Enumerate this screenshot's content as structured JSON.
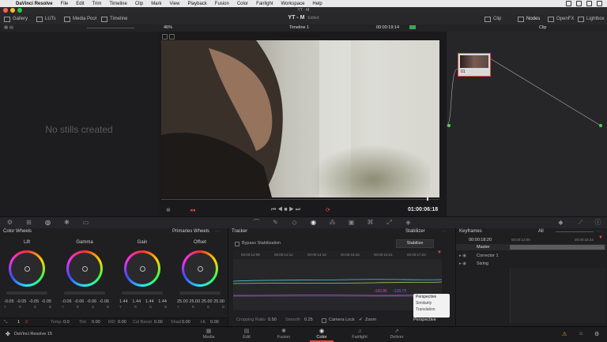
{
  "menubar": {
    "app": "DaVinci Resolve",
    "items": [
      "File",
      "Edit",
      "Trim",
      "Timeline",
      "Clip",
      "Mark",
      "View",
      "Playback",
      "Fusion",
      "Color",
      "Fairlight",
      "Workspace",
      "Help"
    ]
  },
  "window": {
    "title": "YT - M"
  },
  "toolbar": {
    "gallery": "Gallery",
    "luts": "LUTs",
    "media_pool": "Media Pool",
    "timeline": "Timeline",
    "project": "YT - M",
    "edited": "Edited",
    "clip": "Clip",
    "nodes": "Nodes",
    "openfx": "OpenFX",
    "lightbox": "Lightbox"
  },
  "viewerbar": {
    "zoom": "46%",
    "timeline_name": "Timeline 1",
    "timecode": "00:00:19:14",
    "mode": "Clip"
  },
  "gallery": {
    "empty_text": "No stills created"
  },
  "viewer": {
    "timecode": "01:00:06:18"
  },
  "node": {
    "label": "01"
  },
  "wheels": {
    "panel_title": "Color Wheels",
    "mode": "Primaries Wheels",
    "items": [
      {
        "name": "Lift",
        "values": [
          "-0.05",
          "-0.05",
          "-0.05",
          "-0.05"
        ]
      },
      {
        "name": "Gamma",
        "values": [
          "-0.06",
          "-0.06",
          "-0.06",
          "-0.06"
        ]
      },
      {
        "name": "Gain",
        "values": [
          "1.44",
          "1.44",
          "1.44",
          "1.44"
        ]
      },
      {
        "name": "Offset",
        "values": [
          "25.00",
          "25.00",
          "25.00",
          "25.00"
        ]
      }
    ],
    "channel_labels": [
      "Y",
      "R",
      "G",
      "B"
    ],
    "footer": {
      "page1": "1",
      "page2": "2",
      "temp_label": "Temp",
      "temp": "0.0",
      "tint_label": "Tint",
      "tint": "0.00",
      "md_label": "MD",
      "md": "0.00",
      "colboost_label": "Col Boost",
      "colboost": "0.00",
      "shad_label": "Shad",
      "shad": "0.00",
      "hl_label": "HL",
      "hl": "0.00"
    }
  },
  "tracker": {
    "title": "Tracker",
    "mode": "Stabilizer",
    "bypass": "Bypass Stabilization",
    "stabilize_btn": "Stabilize",
    "ruler": [
      "00:00:12:09",
      "00:00:13:12",
      "00:00:14:15",
      "00:00:15:18",
      "00:00:16:21",
      "00:00:17:24"
    ],
    "val1": "-162.85",
    "val2": "-128.73",
    "cropping_label": "Cropping Ratio",
    "cropping": "0.50",
    "smooth_label": "Smooth",
    "smooth": "0.25",
    "camlock": "Camera Lock",
    "zoom": "Zoom",
    "dropdown_options": [
      "Perspective",
      "Similarity",
      "Translation"
    ],
    "dropdown_value": "Perspective"
  },
  "keyframes": {
    "title": "Keyframes",
    "filter": "All",
    "tc_current": "00:00:18:20",
    "tc_left": "00:00:12:09",
    "tc_right": "00:00:16:23",
    "rows": [
      "Master",
      "Corrector 1",
      "Sizing"
    ]
  },
  "pagebar": {
    "app_name": "DaVinci Resolve 15",
    "pages": [
      {
        "name": "Media",
        "icon": "▦"
      },
      {
        "name": "Edit",
        "icon": "▤"
      },
      {
        "name": "Fusion",
        "icon": "✺"
      },
      {
        "name": "Color",
        "icon": "◉"
      },
      {
        "name": "Fairlight",
        "icon": "♫"
      },
      {
        "name": "Deliver",
        "icon": "➚"
      }
    ],
    "active": "Color"
  },
  "colors": {
    "accent": "#e64b3c",
    "active_page": "#e8e8e8",
    "panel_bg": "#1f1f21"
  }
}
